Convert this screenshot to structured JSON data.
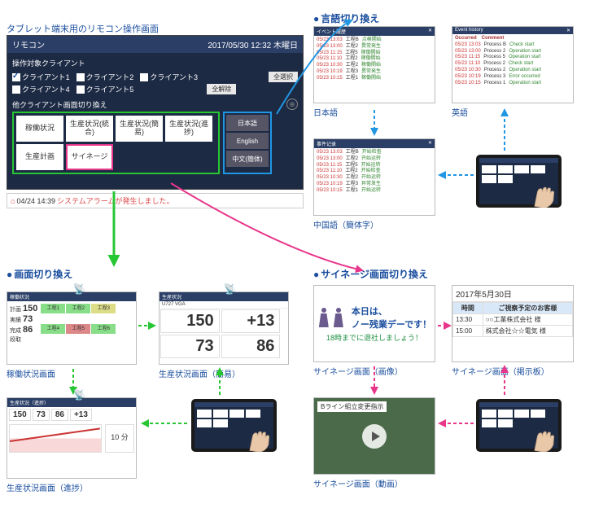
{
  "title": "タブレット端末用のリモコン操作画面",
  "remote": {
    "bar_title": "リモコン",
    "timestamp": "2017/05/30 12:32 木曜日",
    "client_section": "操作対象クライアント",
    "clients": [
      "クライアント1",
      "クライアント2",
      "クライアント3",
      "クライアント4",
      "クライアント5"
    ],
    "select_all": "全選択",
    "deselect_all": "全解除",
    "screen_section": "他クライアント画面切り換え",
    "screen_buttons": [
      "稼働状況",
      "生産状況(統合)",
      "生産状況(簡易)",
      "生産状況(進捗)",
      "生産計画",
      "サイネージ"
    ],
    "lang_buttons": [
      "日本語",
      "English",
      "中文(簡体)"
    ]
  },
  "alarm": {
    "time": "04/24 14:39",
    "text": "システムアラームが発生しました。"
  },
  "sections": {
    "lang": "言語切り換え",
    "screen": "画面切り換え",
    "signage": "サイネージ画面切り換え"
  },
  "lang_panels": {
    "jp": {
      "title": "イベント履歴",
      "rows": [
        {
          "t": "05/23 13:03",
          "p": "工程B",
          "m": "点検開始"
        },
        {
          "t": "05/23 13:00",
          "p": "工程2",
          "m": "異常発生"
        },
        {
          "t": "05/23 11:15",
          "p": "工程5",
          "m": "稼働開始"
        },
        {
          "t": "05/23 11:10",
          "p": "工程2",
          "m": "稼働開始"
        },
        {
          "t": "05/23 10:30",
          "p": "工程2",
          "m": "稼働開始"
        },
        {
          "t": "05/23 10:19",
          "p": "工程3",
          "m": "異常発生"
        },
        {
          "t": "05/23 10:15",
          "p": "工程1",
          "m": "稼働開始"
        }
      ],
      "label": "日本語"
    },
    "en": {
      "title": "Event history",
      "header": "Occurred　Comment",
      "rows": [
        {
          "t": "05/23 13:03",
          "p": "Process B",
          "m": "Check start"
        },
        {
          "t": "05/23 13:00",
          "p": "Process 2",
          "m": "Operation start"
        },
        {
          "t": "05/23 11:15",
          "p": "Process 5",
          "m": "Operation start"
        },
        {
          "t": "05/23 11:10",
          "p": "Process 2",
          "m": "Check start"
        },
        {
          "t": "05/23 10:30",
          "p": "Process 2",
          "m": "Operation start"
        },
        {
          "t": "05/23 10:19",
          "p": "Process 3",
          "m": "Error occurred"
        },
        {
          "t": "05/23 10:15",
          "p": "Process 1",
          "m": "Operation start"
        }
      ],
      "label": "英語"
    },
    "cn": {
      "title": "事件记录",
      "rows": [
        {
          "t": "05/23 13:03",
          "p": "工程B",
          "m": "开始检查"
        },
        {
          "t": "05/23 13:00",
          "p": "工程2",
          "m": "开始运转"
        },
        {
          "t": "05/23 11:15",
          "p": "工程5",
          "m": "开始运转"
        },
        {
          "t": "05/23 11:10",
          "p": "工程2",
          "m": "开始检查"
        },
        {
          "t": "05/23 10:30",
          "p": "工程2",
          "m": "开始运转"
        },
        {
          "t": "05/23 10:19",
          "p": "工程3",
          "m": "异常发生"
        },
        {
          "t": "05/23 10:15",
          "p": "工程1",
          "m": "开始运转"
        }
      ],
      "label": "中国語（簡体字）"
    }
  },
  "screen_panels": {
    "kadou": {
      "title": "稼働状況",
      "label": "稼働状況画面",
      "left_col": [
        "計画",
        "実績",
        "完成",
        "段取"
      ],
      "nums": [
        "150",
        "73",
        "86"
      ],
      "procs": [
        "工程1",
        "工程2",
        "工程3",
        "工程4",
        "工程5",
        "工程6"
      ]
    },
    "simple": {
      "title": "生産状況",
      "label": "生産状況画面（簡易）",
      "model": "U727 VGA",
      "vals": [
        "150",
        "+13",
        "73",
        "86"
      ]
    },
    "progress": {
      "title": "生産状況（進捗）",
      "label": "生産状況画面（進捗）",
      "nums": [
        "150",
        "73",
        "86",
        "+13"
      ],
      "side": [
        "10 分"
      ]
    }
  },
  "signage_panels": {
    "image": {
      "line1": "本日は、",
      "line2": "ノー残業デーです！",
      "line3": "18時までに退社しましょう！",
      "label": "サイネージ画面（画像）"
    },
    "board": {
      "date": "2017年5月30日",
      "th1": "時間",
      "th2": "ご視察予定のお客様",
      "rows": [
        {
          "t": "13:30",
          "c": "○○工業株式会社 様"
        },
        {
          "t": "15:00",
          "c": "株式会社☆☆電気 様"
        }
      ],
      "label": "サイネージ画面（掲示板）"
    },
    "video": {
      "caption": "Bライン組立変更指示",
      "label": "サイネージ画面（動画）"
    }
  }
}
